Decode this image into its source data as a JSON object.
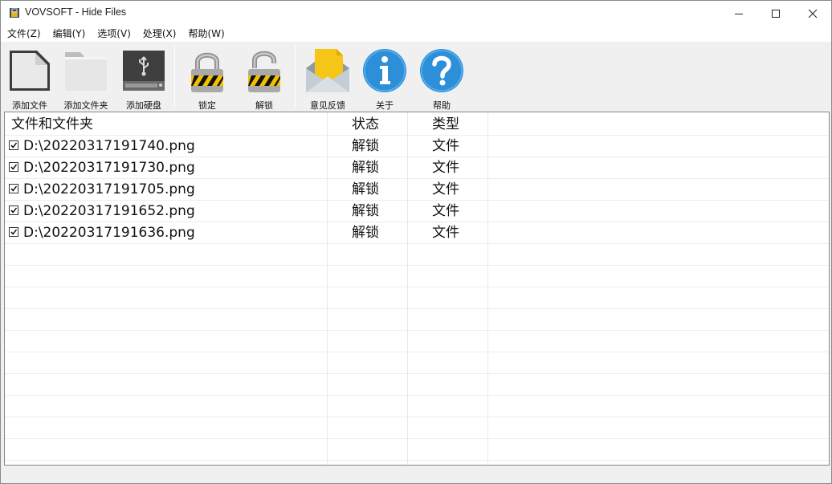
{
  "window": {
    "title": "VOVSOFT - Hide Files"
  },
  "menu": [
    "文件(Z)",
    "编辑(Y)",
    "选项(V)",
    "处理(X)",
    "帮助(W)"
  ],
  "toolbar": {
    "add_file": "添加文件",
    "add_folder": "添加文件夹",
    "add_drive": "添加硬盘",
    "lock": "锁定",
    "unlock": "解锁",
    "feedback": "意见反馈",
    "about": "关于",
    "help": "帮助"
  },
  "list": {
    "columns": [
      "文件和文件夹",
      "状态",
      "类型"
    ],
    "rows": [
      {
        "checked": true,
        "path": "D:\\20220317191740.png",
        "status": "解锁",
        "type": "文件"
      },
      {
        "checked": true,
        "path": "D:\\20220317191730.png",
        "status": "解锁",
        "type": "文件"
      },
      {
        "checked": true,
        "path": "D:\\20220317191705.png",
        "status": "解锁",
        "type": "文件"
      },
      {
        "checked": true,
        "path": "D:\\20220317191652.png",
        "status": "解锁",
        "type": "文件"
      },
      {
        "checked": true,
        "path": "D:\\20220317191636.png",
        "status": "解锁",
        "type": "文件"
      }
    ]
  },
  "colors": {
    "accent_blue": "#2d8fd8",
    "feedback_yellow": "#f5c518"
  }
}
